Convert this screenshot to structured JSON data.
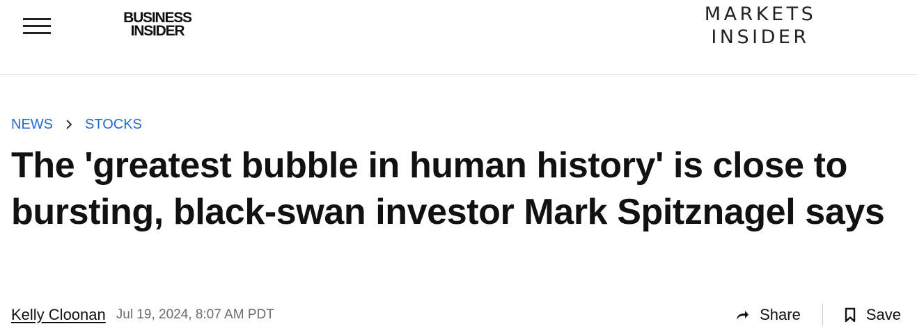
{
  "header": {
    "menu_icon": "hamburger-menu-icon",
    "brand_logo_lines": [
      "BUSINESS",
      "INSIDER"
    ],
    "section_logo_lines": [
      "MARKETS",
      "INSIDER"
    ]
  },
  "breadcrumb": {
    "items": [
      {
        "label": "NEWS"
      },
      {
        "label": "STOCKS"
      }
    ],
    "separator_icon": "chevron-right-icon",
    "link_color": "#2468d4"
  },
  "article": {
    "headline": "The 'greatest bubble in human history' is close to bursting, black-swan investor Mark Spitznagel says",
    "author": "Kelly Cloonan",
    "date": "Jul 19, 2024, 8:07 AM PDT"
  },
  "actions": {
    "share_label": "Share",
    "share_icon": "share-arrow-icon",
    "save_label": "Save",
    "save_icon": "bookmark-icon"
  }
}
